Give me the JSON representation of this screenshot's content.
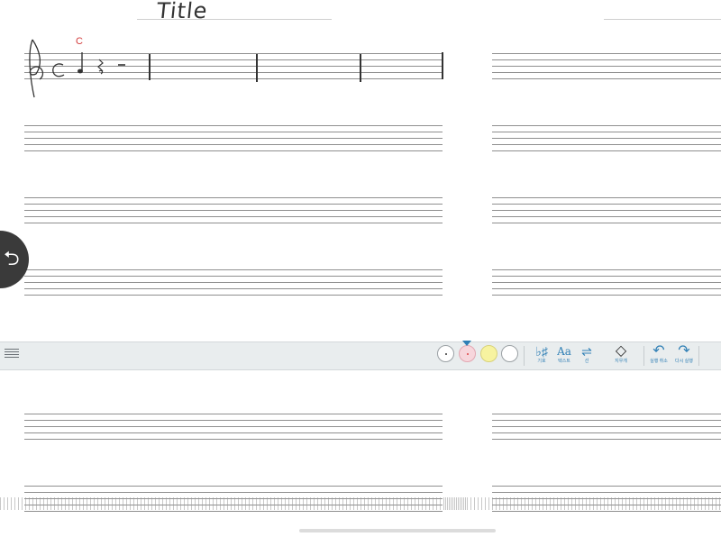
{
  "score": {
    "title_ink": "Title",
    "chord_symbol": "C",
    "time_signature": "C"
  },
  "toolbar": {
    "items": [
      {
        "name": "accidentals",
        "glyph": "♭♯",
        "caption": "기호"
      },
      {
        "name": "text",
        "glyph": "Aa",
        "caption": "텍스트"
      },
      {
        "name": "lines",
        "glyph": "⇌",
        "caption": "선"
      },
      {
        "name": "eraser",
        "glyph": "◇",
        "caption": "지우개"
      },
      {
        "name": "undo",
        "glyph": "↶",
        "caption": "실행 취소"
      },
      {
        "name": "redo",
        "glyph": "↷",
        "caption": "다시 실행"
      }
    ],
    "colors": {
      "black": "#ffffff",
      "pink": "#f7d6dc",
      "yellow": "#f7f3a0",
      "white": "#ffffff",
      "accent": "#2f7fb5"
    }
  },
  "back_button": {
    "icon": "return-arrow-icon",
    "glyph": "⮌"
  }
}
